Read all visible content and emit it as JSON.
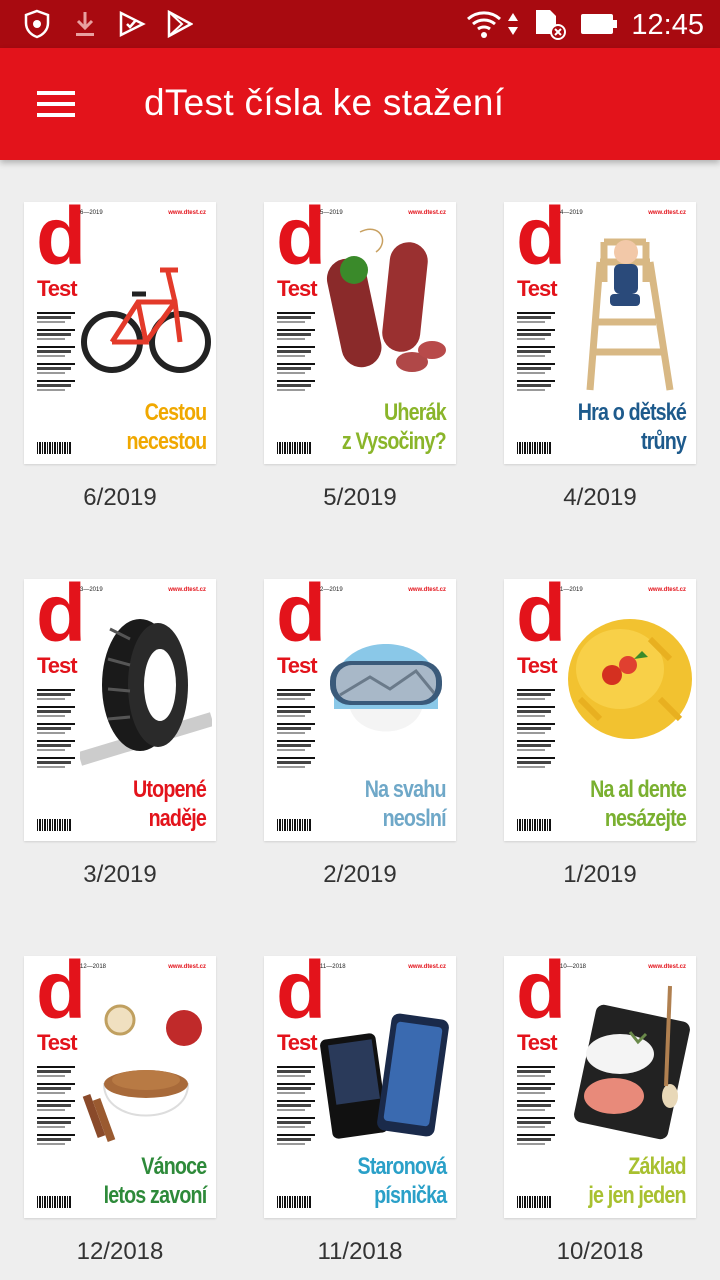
{
  "status_bar": {
    "time": "12:45",
    "icons": [
      "shield-icon",
      "download-icon",
      "play-protect-icon",
      "play-store-icon",
      "wifi-icon",
      "data-arrows-icon",
      "sd-card-icon",
      "battery-icon"
    ]
  },
  "app_bar": {
    "title": "dTest čísla ke stažení",
    "menu_icon": "hamburger-menu-icon"
  },
  "colors": {
    "status_bar": "#a80a10",
    "app_bar": "#e3131b",
    "background": "#eeeeee",
    "brand_red": "#e3131b"
  },
  "issues": [
    {
      "label": "6/2019",
      "cover": {
        "logo_d": "d",
        "logo_test": "Test",
        "issue_no": "6—2019",
        "web": "www.dtest.cz",
        "headline": [
          "Cestou",
          "necestou"
        ],
        "headline_color": "#f0a800",
        "illustration": "bicycle-image"
      }
    },
    {
      "label": "5/2019",
      "cover": {
        "logo_d": "d",
        "logo_test": "Test",
        "issue_no": "5—2019",
        "web": "www.dtest.cz",
        "headline": [
          "Uherák",
          "z Vysočiny?"
        ],
        "headline_color": "#8ab52a",
        "illustration": "salami-image"
      }
    },
    {
      "label": "4/2019",
      "cover": {
        "logo_d": "d",
        "logo_test": "Test",
        "issue_no": "4—2019",
        "web": "www.dtest.cz",
        "headline": [
          "Hra o dětské",
          "trůny"
        ],
        "headline_color": "#1d5a8c",
        "illustration": "high-chair-image"
      }
    },
    {
      "label": "3/2019",
      "cover": {
        "logo_d": "d",
        "logo_test": "Test",
        "issue_no": "3—2019",
        "web": "www.dtest.cz",
        "headline": [
          "Utopené",
          "naděje"
        ],
        "headline_color": "#e3131b",
        "illustration": "tire-image"
      }
    },
    {
      "label": "2/2019",
      "cover": {
        "logo_d": "d",
        "logo_test": "Test",
        "issue_no": "2—2019",
        "web": "www.dtest.cz",
        "headline": [
          "Na svahu",
          "neoslní"
        ],
        "headline_color": "#6fa8c8",
        "illustration": "ski-helmet-image"
      }
    },
    {
      "label": "1/2019",
      "cover": {
        "logo_d": "d",
        "logo_test": "Test",
        "issue_no": "1—2019",
        "web": "www.dtest.cz",
        "headline": [
          "Na al dente",
          "nesázejte"
        ],
        "headline_color": "#7ab030",
        "illustration": "pasta-image"
      }
    },
    {
      "label": "12/2018",
      "cover": {
        "logo_d": "d",
        "logo_test": "Test",
        "issue_no": "12—2018",
        "web": "www.dtest.cz",
        "headline": [
          "Vánoce",
          "letos zavoní"
        ],
        "headline_color": "#2e8a3a",
        "illustration": "cinnamon-bowl-image"
      }
    },
    {
      "label": "11/2018",
      "cover": {
        "logo_d": "d",
        "logo_test": "Test",
        "issue_no": "11—2018",
        "web": "www.dtest.cz",
        "headline": [
          "Staronová",
          "písnička"
        ],
        "headline_color": "#2aa0c8",
        "illustration": "phones-image"
      }
    },
    {
      "label": "10/2018",
      "cover": {
        "logo_d": "d",
        "logo_test": "Test",
        "issue_no": "10—2018",
        "web": "www.dtest.cz",
        "headline": [
          "Základ",
          "je jen jeden"
        ],
        "headline_color": "#a8c030",
        "illustration": "salt-board-image"
      }
    }
  ]
}
